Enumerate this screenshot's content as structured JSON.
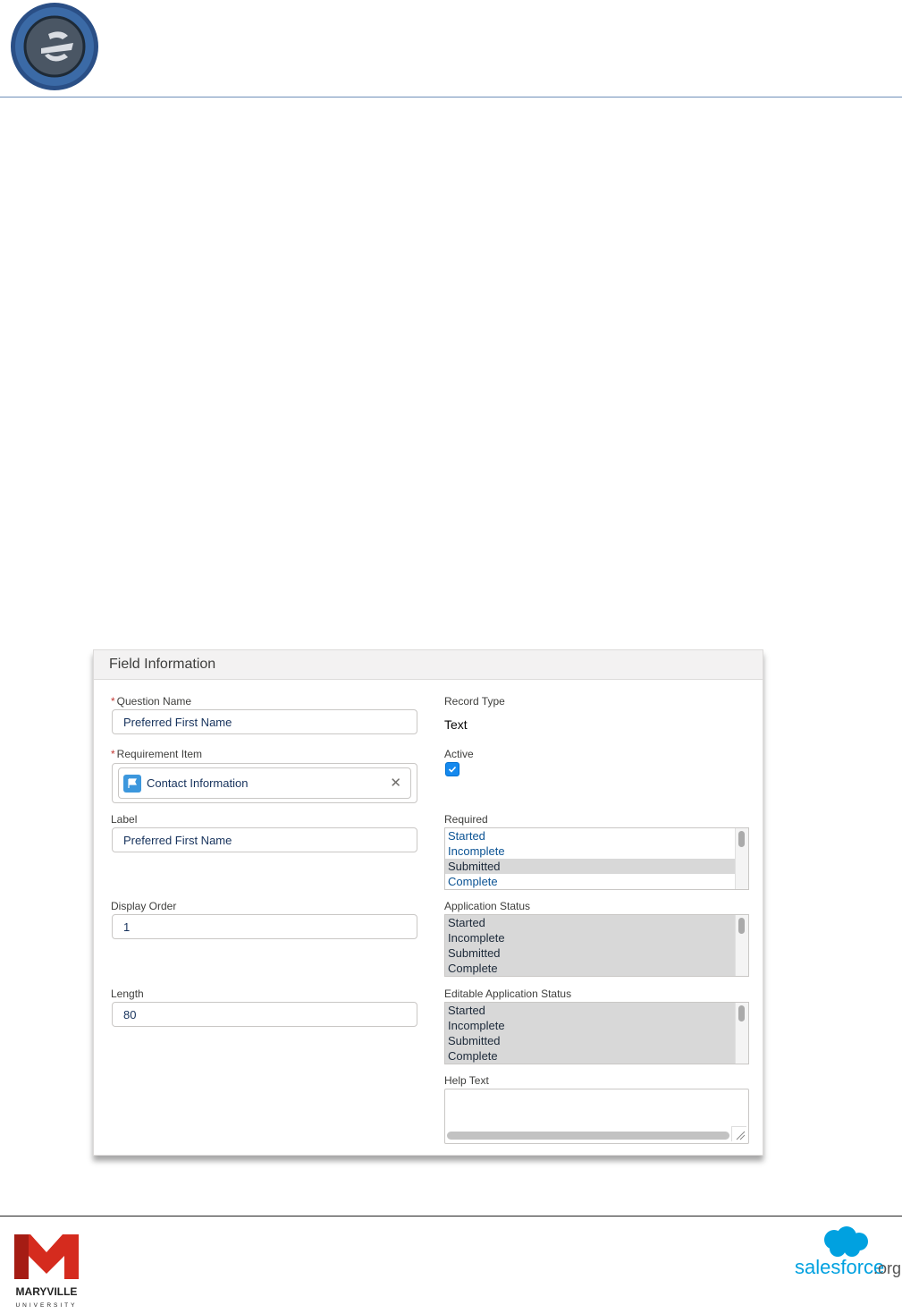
{
  "panel": {
    "title": "Field Information"
  },
  "fields": {
    "question_name": {
      "label": "Question Name",
      "value": "Preferred First Name",
      "required_mark": "*"
    },
    "requirement_item": {
      "label": "Requirement Item",
      "value": "Contact Information",
      "required_mark": "*"
    },
    "label": {
      "label": "Label",
      "value": "Preferred First Name"
    },
    "display_order": {
      "label": "Display Order",
      "value": "1"
    },
    "length": {
      "label": "Length",
      "value": "80"
    },
    "record_type": {
      "label": "Record Type",
      "value": "Text"
    },
    "active": {
      "label": "Active",
      "checked": true
    },
    "required": {
      "label": "Required",
      "options": [
        "Started",
        "Incomplete",
        "Submitted",
        "Complete"
      ],
      "selected": [
        "Submitted"
      ]
    },
    "application_status": {
      "label": "Application Status",
      "options": [
        "Started",
        "Incomplete",
        "Submitted",
        "Complete"
      ],
      "selected": [
        "Started",
        "Incomplete",
        "Submitted",
        "Complete"
      ]
    },
    "editable_application_status": {
      "label": "Editable Application Status",
      "options": [
        "Started",
        "Incomplete",
        "Submitted",
        "Complete"
      ],
      "selected": [
        "Started",
        "Incomplete",
        "Submitted",
        "Complete"
      ]
    },
    "help_text": {
      "label": "Help Text",
      "value": ""
    }
  },
  "footer": {
    "maryville": {
      "line1": "MARYVILLE",
      "line2": "UNIVERSITY"
    },
    "salesforce": {
      "brand": "salesforce",
      "suffix": ".org"
    }
  },
  "colors": {
    "brand_blue": "#1589ee",
    "sf_blue": "#00a1e0",
    "maryville_red": "#d52b1e"
  },
  "icons": {
    "pill": "flag-icon",
    "close": "close-icon",
    "check": "checkmark-icon"
  }
}
